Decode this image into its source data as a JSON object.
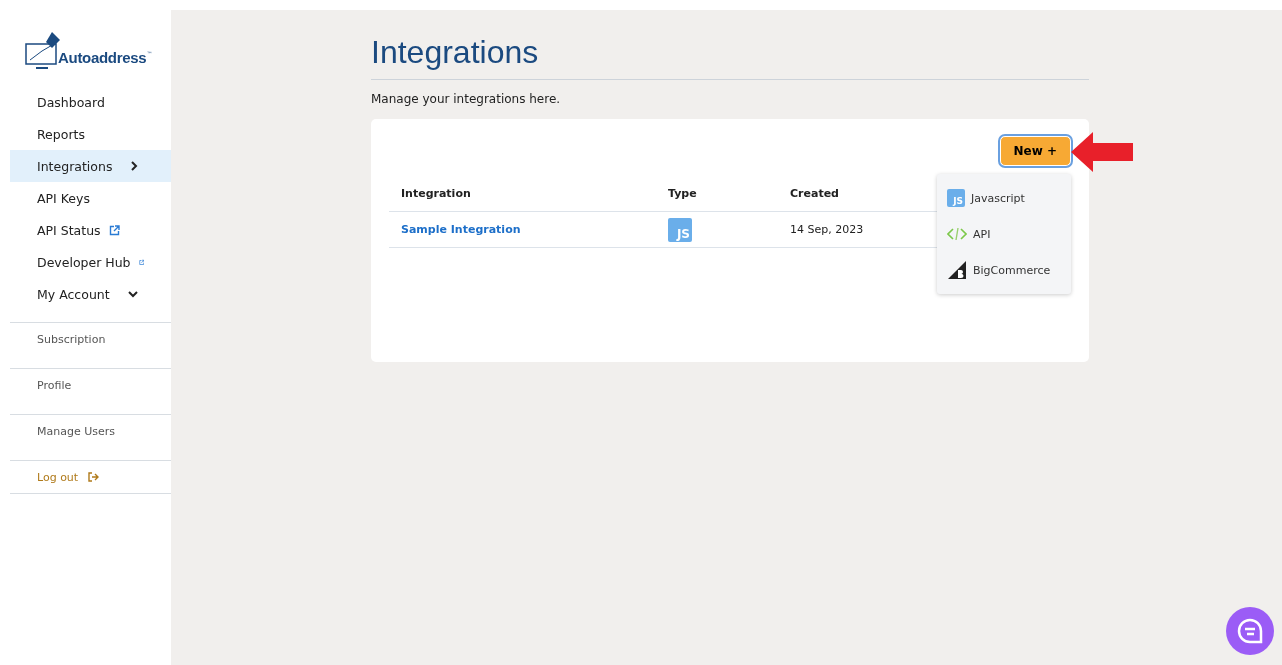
{
  "logo": {
    "name": "Autoaddress",
    "mark": "™"
  },
  "nav": [
    {
      "label": "Dashboard",
      "kind": "main",
      "selected": false
    },
    {
      "label": "Reports",
      "kind": "main",
      "selected": false
    },
    {
      "label": "Integrations",
      "kind": "expand",
      "selected": true
    },
    {
      "label": "API Keys",
      "kind": "main",
      "selected": false
    },
    {
      "label": "API Status",
      "kind": "external",
      "selected": false
    },
    {
      "label": "Developer Hub",
      "kind": "external",
      "selected": false
    },
    {
      "label": "My Account",
      "kind": "dropdown",
      "selected": false
    },
    {
      "label": "Subscription",
      "kind": "sub",
      "selected": false
    },
    {
      "label": "Profile",
      "kind": "sub",
      "selected": false
    },
    {
      "label": "Manage Users",
      "kind": "sub",
      "selected": false
    },
    {
      "label": "Log out",
      "kind": "logout",
      "selected": false
    }
  ],
  "page": {
    "title": "Integrations",
    "subtitle": "Manage your integrations here."
  },
  "new_button": {
    "label": "New",
    "symbol": "+"
  },
  "menu": [
    {
      "label": "Javascript",
      "kind": "js",
      "badge": "JS"
    },
    {
      "label": "API",
      "kind": "api"
    },
    {
      "label": "BigCommerce",
      "kind": "bigcommerce"
    }
  ],
  "table": {
    "columns": [
      "Integration",
      "Type",
      "Created"
    ],
    "rows": [
      {
        "name": "Sample Integration",
        "type_badge": "JS",
        "created": "14 Sep, 2023"
      }
    ]
  }
}
